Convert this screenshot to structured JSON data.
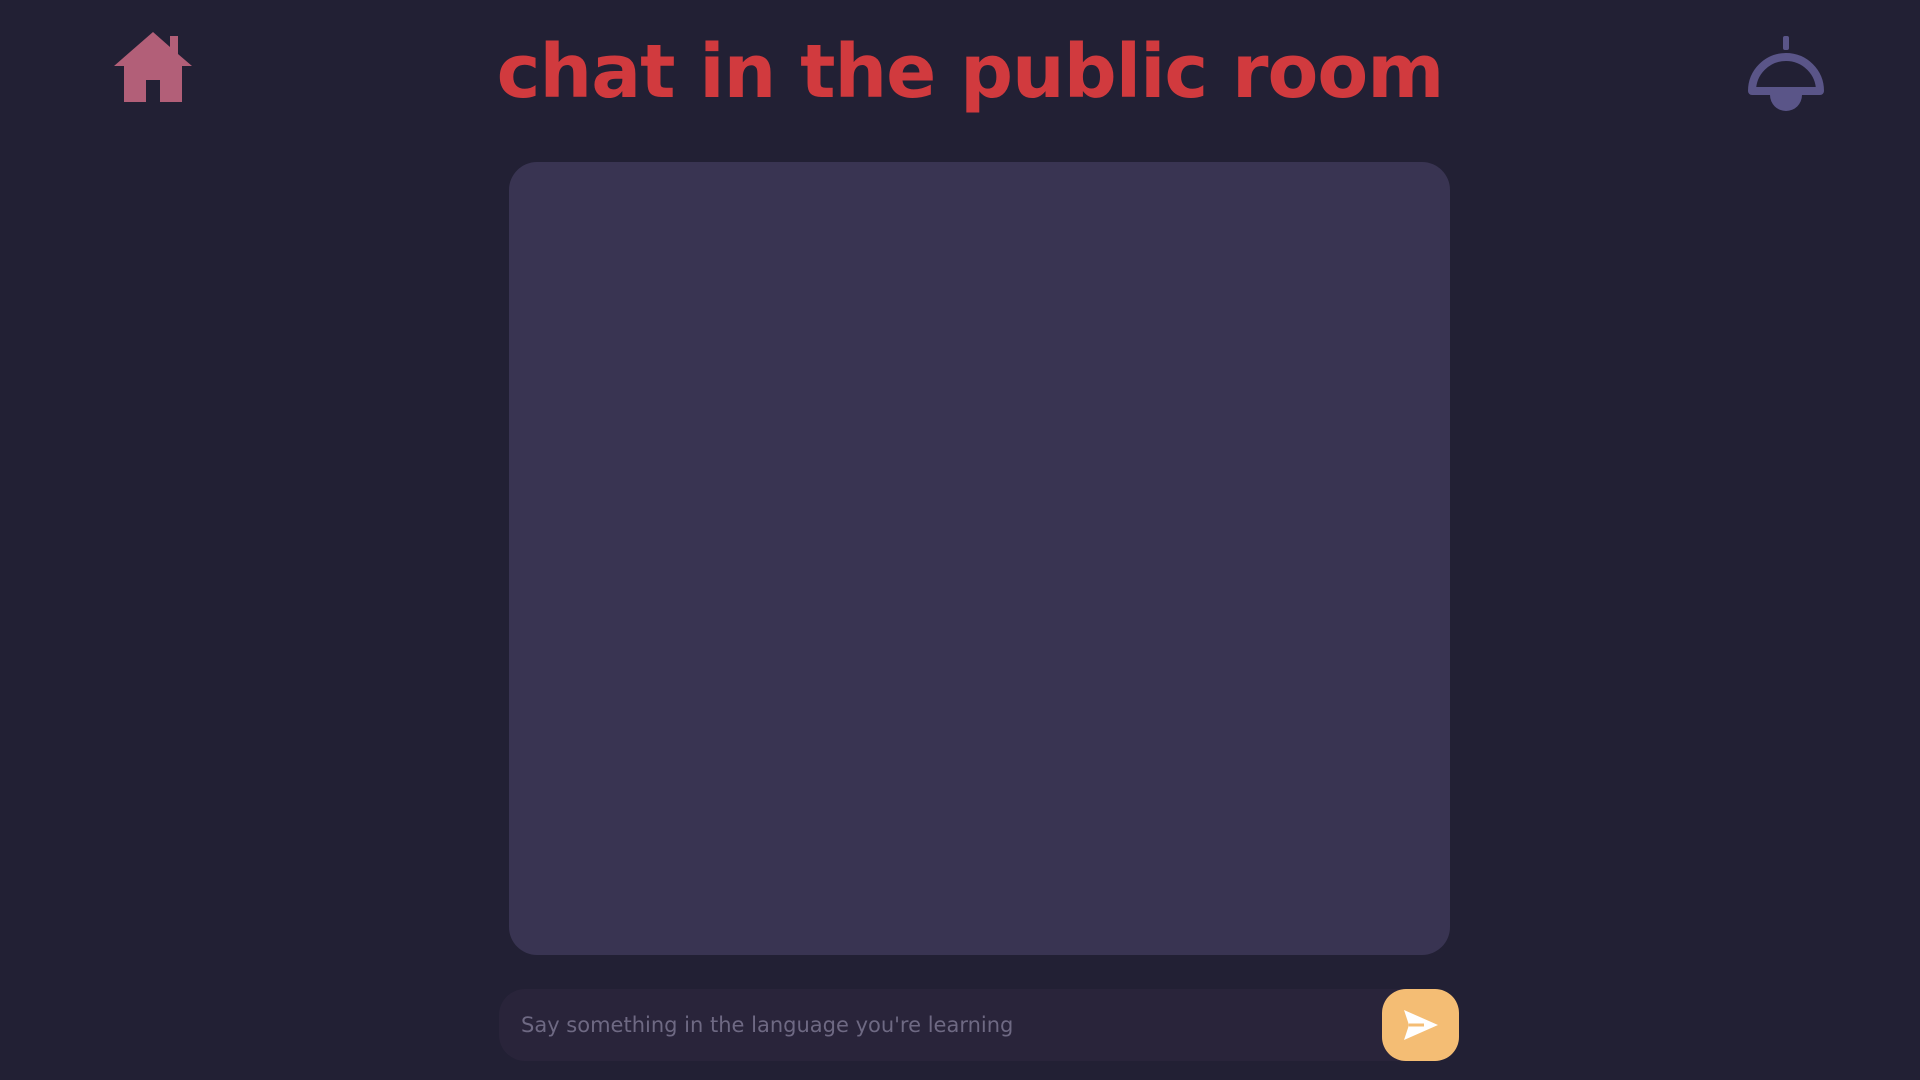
{
  "header": {
    "title": "chat in the public room",
    "home_icon": "home-icon",
    "lamp_icon": "lamp-icon"
  },
  "composer": {
    "placeholder": "Say something in the language you're learning",
    "value": "",
    "send_icon": "send-icon"
  },
  "colors": {
    "background": "#222034",
    "title": "#d13a3e",
    "home_icon": "#b25f78",
    "lamp_icon": "#5a5588",
    "panel": "#393452",
    "composer": "#29243a",
    "send_button": "#f4bd74"
  }
}
